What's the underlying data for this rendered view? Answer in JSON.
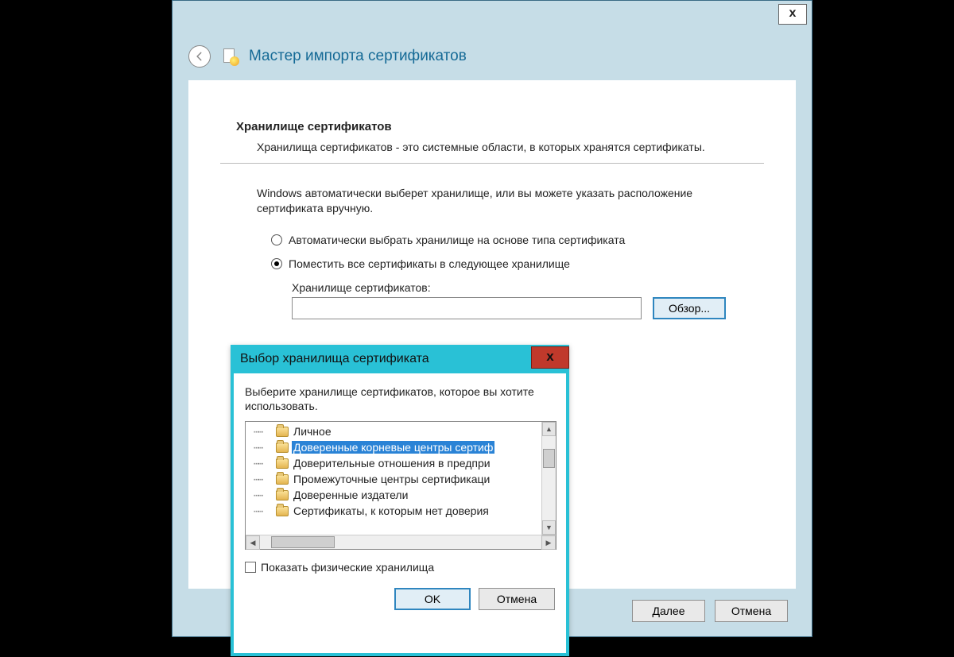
{
  "wizard": {
    "close_glyph": "x",
    "title": "Мастер импорта сертификатов",
    "section_heading": "Хранилище сертификатов",
    "section_desc": "Хранилища сертификатов - это системные области, в которых хранятся сертификаты.",
    "hint": "Windows автоматически выберет хранилище, или вы можете указать расположение сертификата вручную.",
    "radio_auto": "Автоматически выбрать хранилище на основе типа сертификата",
    "radio_manual": "Поместить все сертификаты в следующее хранилище",
    "store_label": "Хранилище сертификатов:",
    "browse_label": "Обзор...",
    "next_label": "Далее",
    "cancel_label": "Отмена"
  },
  "picker": {
    "title": "Выбор хранилища сертификата",
    "close_glyph": "x",
    "prompt": "Выберите хранилище сертификатов, которое вы хотите использовать.",
    "items": [
      "Личное",
      "Доверенные корневые центры сертиф",
      "Доверительные отношения в предпри",
      "Промежуточные центры сертификаци",
      "Доверенные издатели",
      "Сертификаты, к которым нет доверия"
    ],
    "selected_index": 1,
    "show_physical_label": "Показать физические хранилища",
    "ok_label": "OK",
    "cancel_label": "Отмена"
  }
}
